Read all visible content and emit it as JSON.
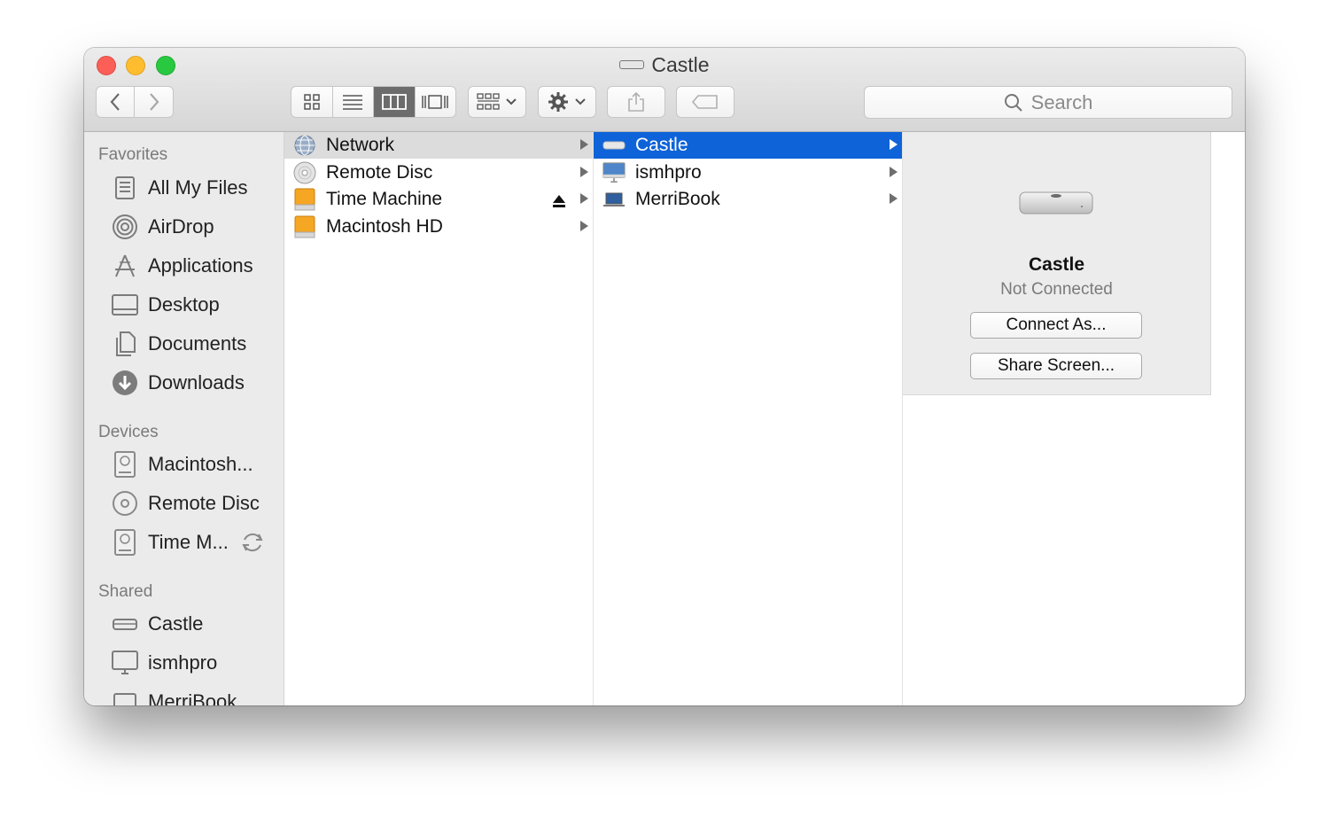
{
  "window": {
    "title": "Castle"
  },
  "toolbar": {
    "back_icon": "chevron-left-icon",
    "forward_icon": "chevron-right-icon",
    "view_modes": [
      "icon-view-icon",
      "list-view-icon",
      "column-view-icon",
      "cover-flow-icon"
    ],
    "active_view": "column-view-icon",
    "search_placeholder": "Search"
  },
  "sidebar": {
    "favorites": {
      "header": "Favorites",
      "items": [
        {
          "label": "All My Files",
          "icon": "all-my-files-icon"
        },
        {
          "label": "AirDrop",
          "icon": "airdrop-icon"
        },
        {
          "label": "Applications",
          "icon": "applications-icon"
        },
        {
          "label": "Desktop",
          "icon": "desktop-icon"
        },
        {
          "label": "Documents",
          "icon": "documents-icon"
        },
        {
          "label": "Downloads",
          "icon": "downloads-icon"
        }
      ]
    },
    "devices": {
      "header": "Devices",
      "items": [
        {
          "label": "Macintosh...",
          "icon": "hard-drive-icon"
        },
        {
          "label": "Remote Disc",
          "icon": "disc-icon"
        },
        {
          "label": "Time M...",
          "icon": "hard-drive-icon"
        }
      ]
    },
    "shared": {
      "header": "Shared",
      "items": [
        {
          "label": "Castle",
          "icon": "server-icon"
        },
        {
          "label": "ismhpro",
          "icon": "imac-icon"
        },
        {
          "label": "MerriBook",
          "icon": "laptop-icon"
        }
      ]
    }
  },
  "columns": {
    "col1": [
      {
        "label": "Network",
        "icon": "network-globe-icon"
      },
      {
        "label": "Remote Disc",
        "icon": "disc-icon"
      },
      {
        "label": "Time Machine",
        "icon": "orange-drive-icon"
      },
      {
        "label": "Macintosh HD",
        "icon": "orange-drive-icon"
      }
    ],
    "col2": [
      {
        "label": "Castle",
        "icon": "mac-mini-icon"
      },
      {
        "label": "ismhpro",
        "icon": "imac-icon"
      },
      {
        "label": "MerriBook",
        "icon": "laptop-icon"
      }
    ]
  },
  "preview": {
    "name": "Castle",
    "status": "Not Connected",
    "connect_label": "Connect As...",
    "share_label": "Share Screen..."
  }
}
